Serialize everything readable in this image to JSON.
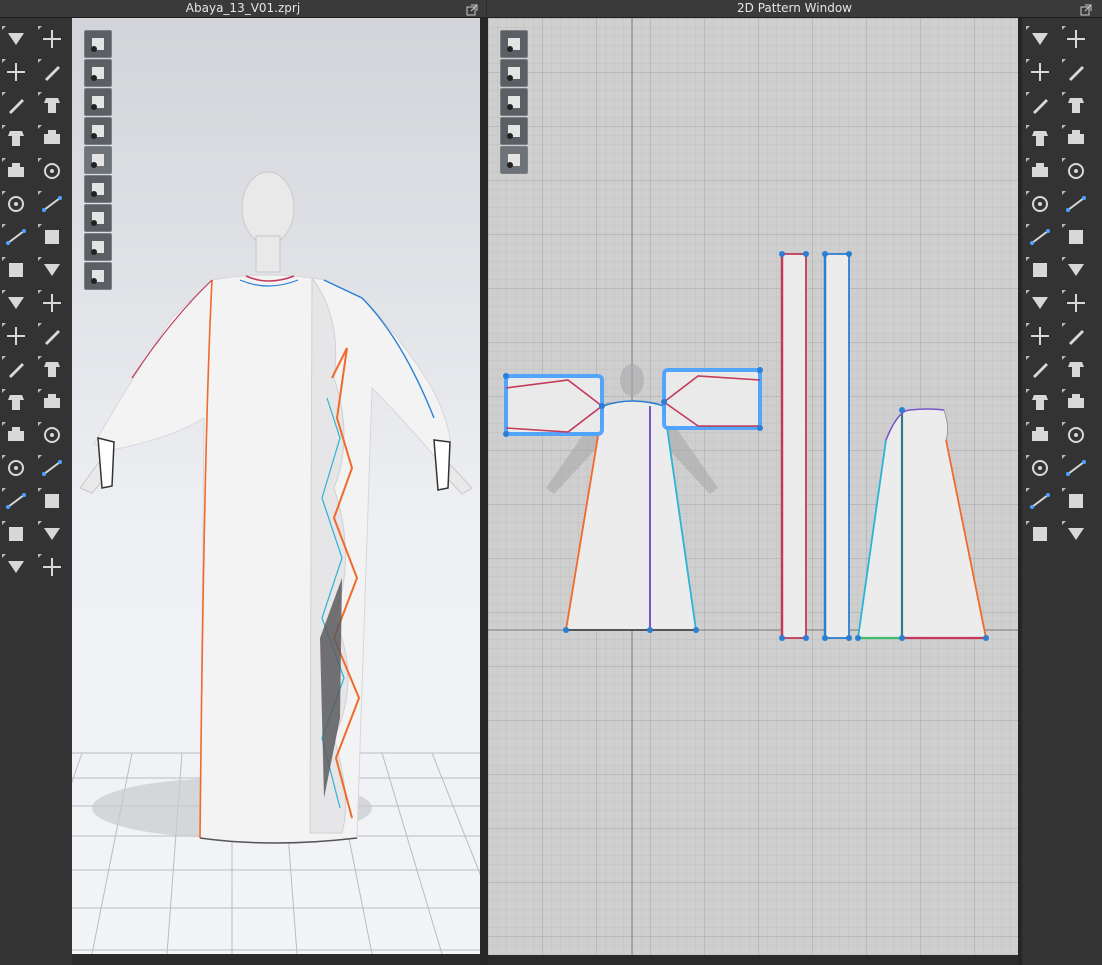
{
  "windows": {
    "left_title": "Abaya_13_V01.zprj",
    "right_title": "2D Pattern Window"
  },
  "colors": {
    "background": "#2b2b2b",
    "toolbar": "#333333",
    "viewport_2d": "#cfcfcf",
    "selection_blue": "#4da3ff",
    "seam_orange": "#f06a2c",
    "seam_blue": "#2a7fd4",
    "seam_cyan": "#2cb3d6",
    "seam_purple": "#7a55c9",
    "seam_red": "#c43a5a",
    "seam_green": "#3fbf6a"
  },
  "toolbars": {
    "left_3d_col1": [
      "move-down-icon",
      "move-icon",
      "brush-icon",
      "garment-icon",
      "sewing-icon",
      "segment-sewing-icon",
      "avatar-pose-icon",
      "pin-icon",
      "fold-icon",
      "measure-icon",
      "puckering-icon",
      "tack-icon",
      "hanger-icon",
      "gradient-icon",
      "fit-icon",
      "trace-icon",
      "zip-icon"
    ],
    "left_3d_col2": [
      "avatar-pose-icon",
      "select-mesh-icon",
      "edit-mesh-icon",
      "edit-curvature-icon",
      "tape-icon",
      "brush-pressure-icon",
      "puckering-icon",
      "fabric-icon",
      "button-icon",
      "buttonhole-icon",
      "zipper-icon",
      "zipper-slider-icon",
      "trim-icon",
      "topstitch-icon",
      "snap-icon",
      "measure-icon",
      "select-icon"
    ],
    "right_2d_col1": [
      "edit-pattern-icon",
      "transform-icon",
      "polygon-icon",
      "rectangle-icon",
      "internal-polygon-icon",
      "dart-icon",
      "fold-arrangement-icon",
      "pleat-icon",
      "notch-icon",
      "trace-icon",
      "rule-icon",
      "text-icon",
      "text-size-icon",
      "grain-icon",
      "grading-icon",
      "avatar-measure-icon"
    ],
    "right_2d_col2": [
      "seam-icon",
      "segment-sewing-icon",
      "free-sewing-icon",
      "tack-icon",
      "iron-icon",
      "garment-icon",
      "sewing-icon",
      "fabric-icon",
      "texture-icon",
      "topstitch-icon",
      "measure-icon",
      "tape-icon",
      "zipper-icon",
      "gradient-icon",
      "block-icon",
      "hanger-icon"
    ]
  },
  "viewport_3d_buttons": [
    "show-avatar-icon",
    "show-garment-icon",
    "show-pattern-icon",
    "show-fabric-icon",
    "show-sewing-icon",
    "show-pins-icon",
    "render-icon",
    "avatar-silhouette-icon",
    "globe-icon"
  ],
  "viewport_2d_buttons": [
    "brush-icon",
    "show-garment-icon",
    "info-icon",
    "pattern-view-icon",
    "show-avatar-icon"
  ]
}
